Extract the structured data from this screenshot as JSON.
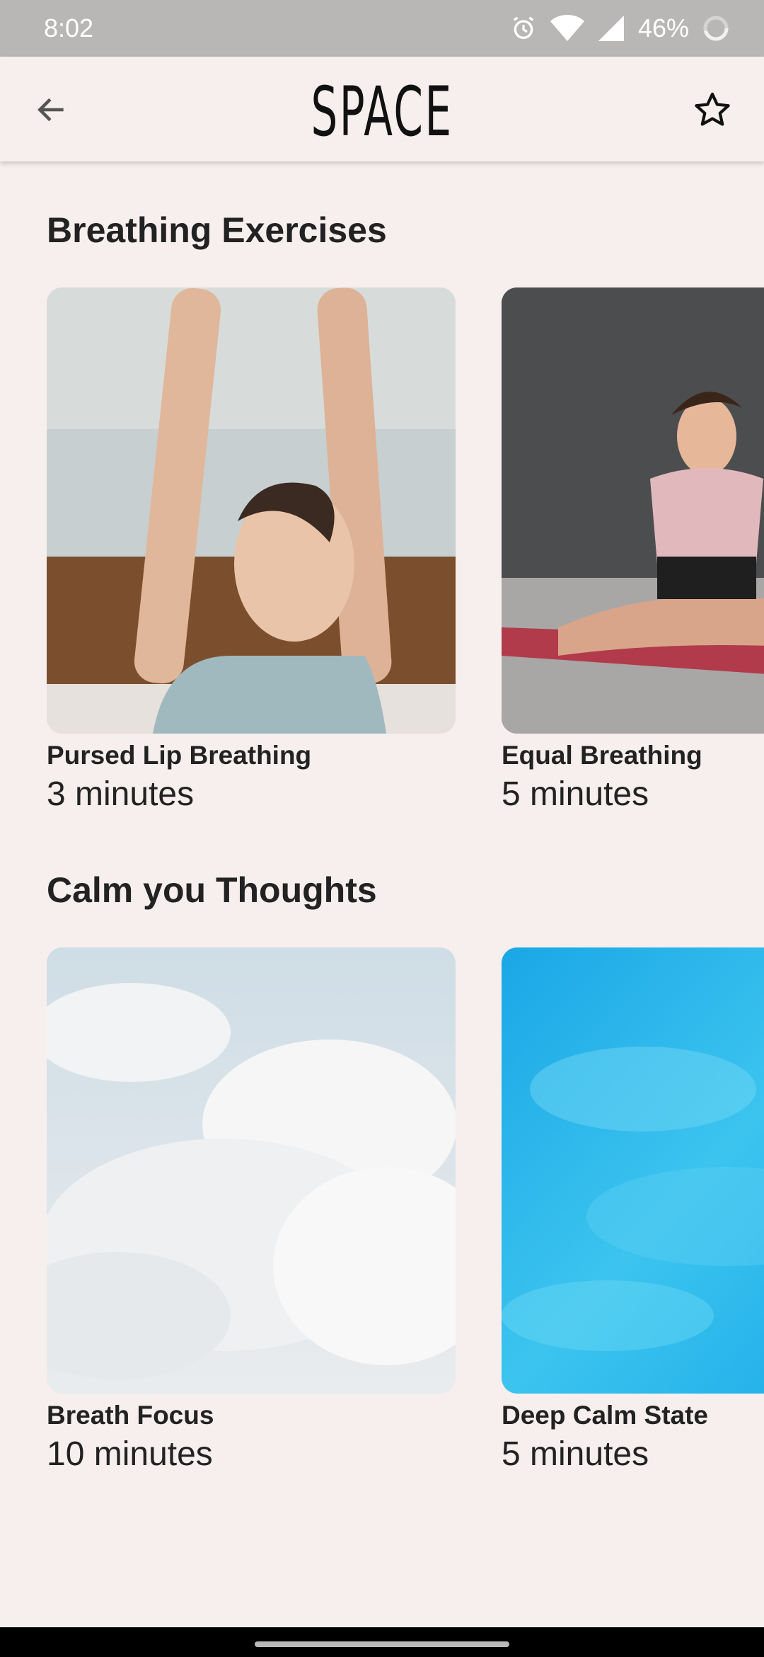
{
  "status_bar": {
    "time": "8:02",
    "battery": "46%",
    "icons": [
      "alarm-icon",
      "wifi-icon",
      "signal-icon",
      "battery-icon"
    ]
  },
  "app_bar": {
    "title": "SPACE",
    "back_icon": "arrow-left-icon",
    "favorite_icon": "star-outline-icon"
  },
  "sections": [
    {
      "title": "Breathing Exercises",
      "cards": [
        {
          "name": "Pursed Lip Breathing",
          "duration": "3 minutes"
        },
        {
          "name": "Equal Breathing",
          "duration": "5 minutes"
        }
      ]
    },
    {
      "title": "Calm you Thoughts",
      "cards": [
        {
          "name": "Breath Focus",
          "duration": "10 minutes"
        },
        {
          "name": "Deep Calm State",
          "duration": "5 minutes"
        }
      ]
    }
  ],
  "colors": {
    "background": "#f7efed",
    "status_bar": "#b9b7b6",
    "text": "#222222"
  }
}
